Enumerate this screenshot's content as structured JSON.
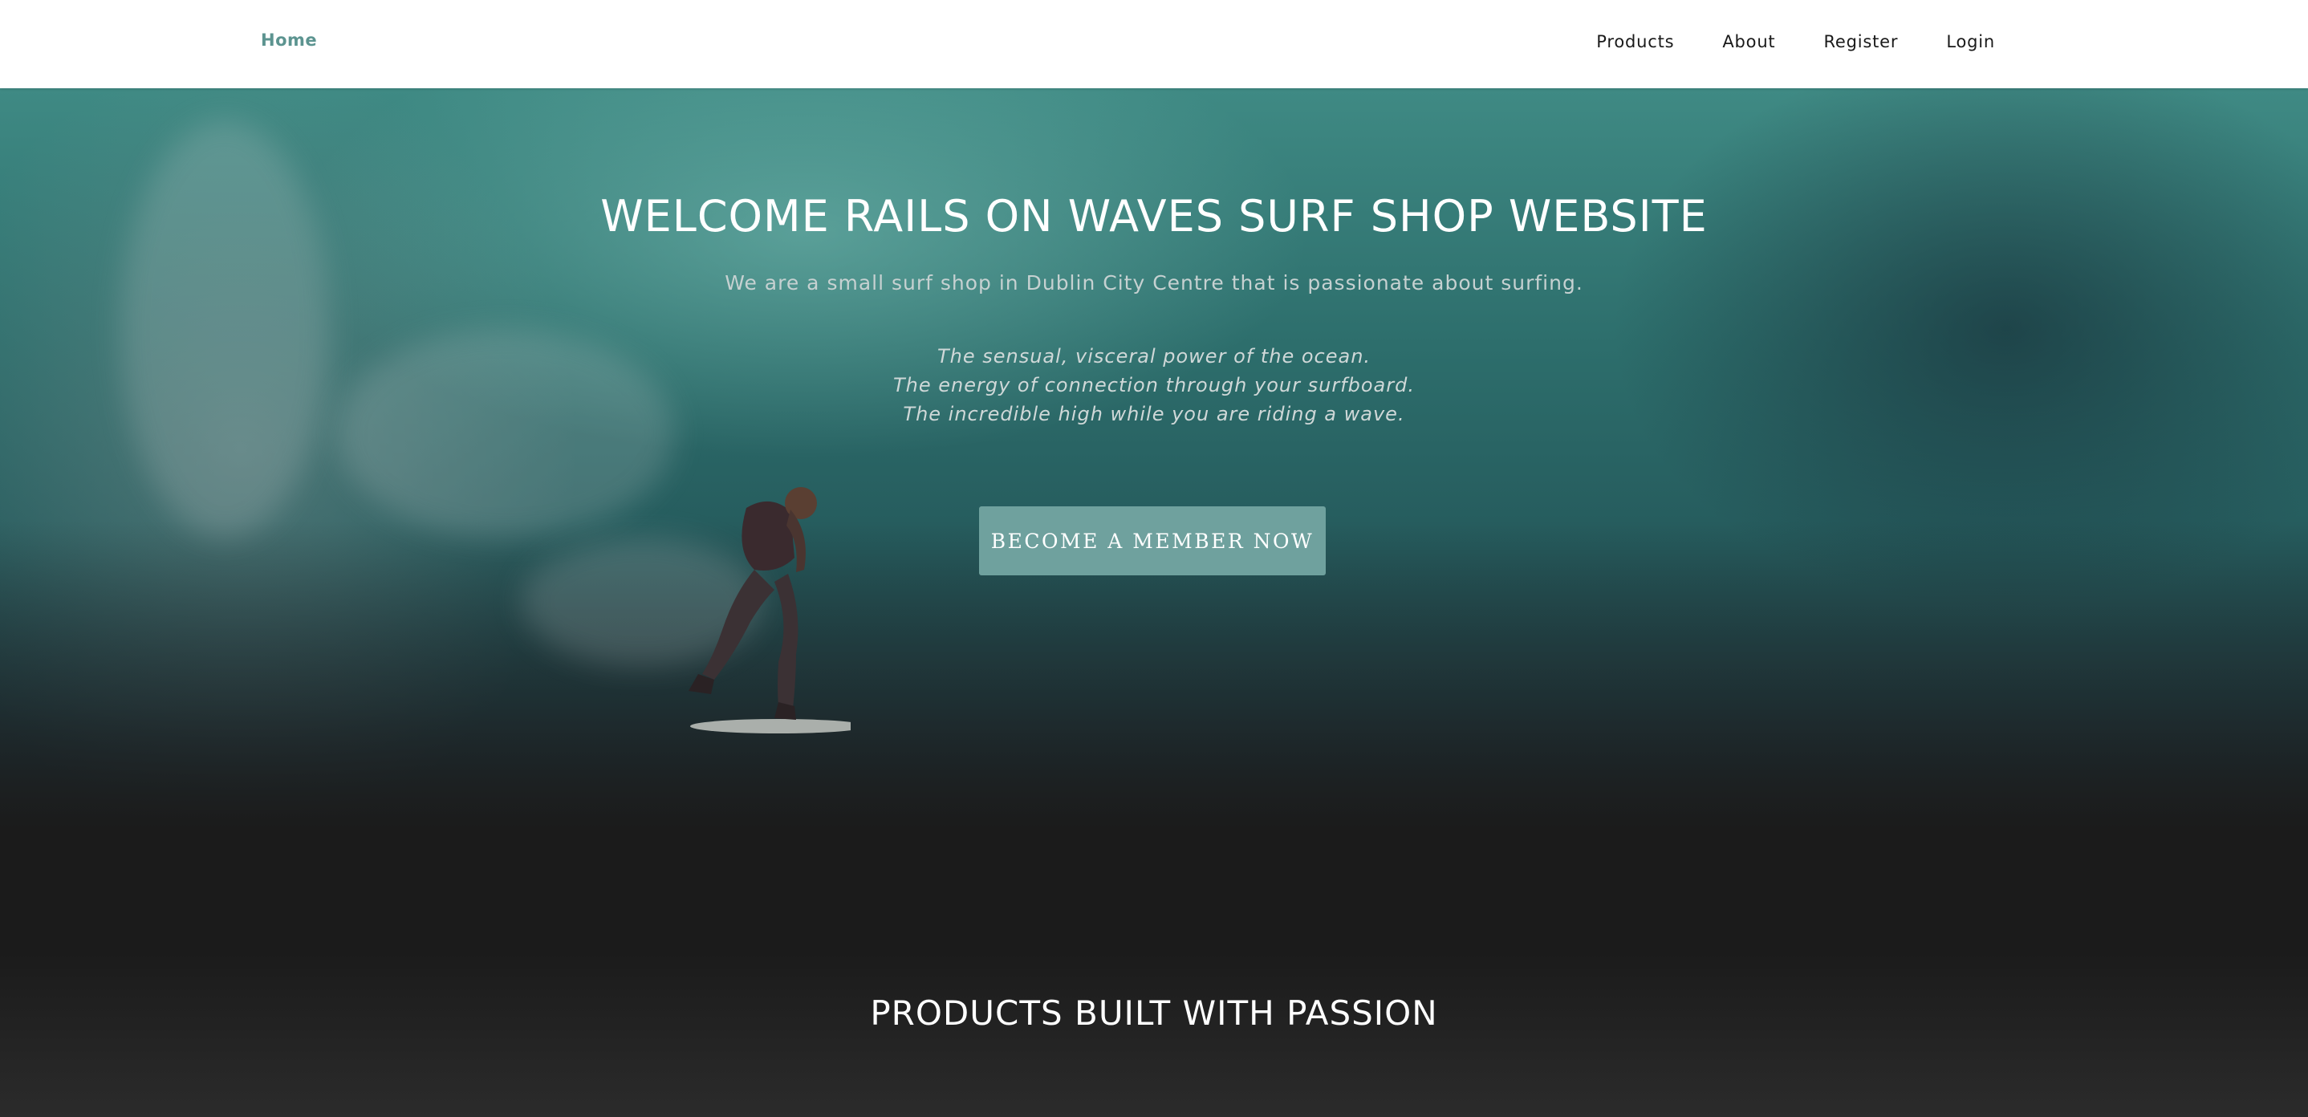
{
  "navbar": {
    "home_label": "Home",
    "links": [
      {
        "label": "Products"
      },
      {
        "label": "About"
      },
      {
        "label": "Register"
      },
      {
        "label": "Login"
      }
    ]
  },
  "hero": {
    "title": "WELCOME RAILS ON WAVES SURF SHOP WEBSITE",
    "subtitle": "We are a small surf shop in Dublin City Centre that is passionate about surfing.",
    "lines": [
      "The sensual, visceral power of the ocean.",
      "The energy of connection through your surfboard.",
      "The incredible high while you are riding a wave."
    ],
    "cta_label": "BECOME A MEMBER NOW"
  },
  "products_section": {
    "title": "PRODUCTS BUILT WITH PASSION"
  },
  "colors": {
    "accent": "#6fa19e",
    "home_link": "#5c9490",
    "navbar_bg": "#ffffff",
    "dark_bg": "#1b1b1b"
  }
}
